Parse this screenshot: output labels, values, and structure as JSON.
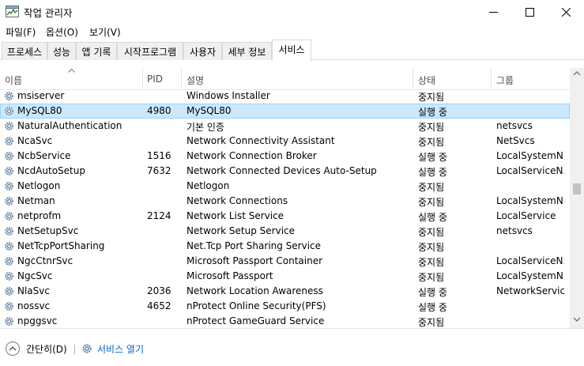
{
  "window": {
    "title": "작업 관리자"
  },
  "menu": [
    {
      "label": "파일(F)"
    },
    {
      "label": "옵션(O)"
    },
    {
      "label": "보기(V)"
    }
  ],
  "tabs": [
    {
      "label": "프로세스",
      "active": false
    },
    {
      "label": "성능",
      "active": false
    },
    {
      "label": "앱 기록",
      "active": false
    },
    {
      "label": "시작프로그램",
      "active": false
    },
    {
      "label": "사용자",
      "active": false
    },
    {
      "label": "세부 정보",
      "active": false
    },
    {
      "label": "서비스",
      "active": true
    }
  ],
  "columns": {
    "name": "이름",
    "pid": "PID",
    "desc": "설명",
    "status": "상태",
    "group": "그룹"
  },
  "rows": [
    {
      "name": "msiserver",
      "pid": "",
      "desc": "Windows Installer",
      "status": "중지됨",
      "group": "",
      "selected": false
    },
    {
      "name": "MySQL80",
      "pid": "4980",
      "desc": "MySQL80",
      "status": "실행 중",
      "group": "",
      "selected": true
    },
    {
      "name": "NaturalAuthentication",
      "pid": "",
      "desc": "기본 인증",
      "status": "중지됨",
      "group": "netsvcs",
      "selected": false
    },
    {
      "name": "NcaSvc",
      "pid": "",
      "desc": "Network Connectivity Assistant",
      "status": "중지됨",
      "group": "NetSvcs",
      "selected": false
    },
    {
      "name": "NcbService",
      "pid": "1516",
      "desc": "Network Connection Broker",
      "status": "실행 중",
      "group": "LocalSystemN...",
      "selected": false
    },
    {
      "name": "NcdAutoSetup",
      "pid": "7632",
      "desc": "Network Connected Devices Auto-Setup",
      "status": "실행 중",
      "group": "LocalServiceN...",
      "selected": false
    },
    {
      "name": "Netlogon",
      "pid": "",
      "desc": "Netlogon",
      "status": "중지됨",
      "group": "",
      "selected": false
    },
    {
      "name": "Netman",
      "pid": "",
      "desc": "Network Connections",
      "status": "중지됨",
      "group": "LocalSystemN...",
      "selected": false
    },
    {
      "name": "netprofm",
      "pid": "2124",
      "desc": "Network List Service",
      "status": "실행 중",
      "group": "LocalService",
      "selected": false
    },
    {
      "name": "NetSetupSvc",
      "pid": "",
      "desc": "Network Setup Service",
      "status": "중지됨",
      "group": "netsvcs",
      "selected": false
    },
    {
      "name": "NetTcpPortSharing",
      "pid": "",
      "desc": "Net.Tcp Port Sharing Service",
      "status": "중지됨",
      "group": "",
      "selected": false
    },
    {
      "name": "NgcCtnrSvc",
      "pid": "",
      "desc": "Microsoft Passport Container",
      "status": "중지됨",
      "group": "LocalServiceN...",
      "selected": false
    },
    {
      "name": "NgcSvc",
      "pid": "",
      "desc": "Microsoft Passport",
      "status": "중지됨",
      "group": "LocalSystemN...",
      "selected": false
    },
    {
      "name": "NlaSvc",
      "pid": "2036",
      "desc": "Network Location Awareness",
      "status": "실행 중",
      "group": "NetworkService",
      "selected": false
    },
    {
      "name": "nossvc",
      "pid": "4652",
      "desc": "nProtect Online Security(PFS)",
      "status": "실행 중",
      "group": "",
      "selected": false
    },
    {
      "name": "npggsvc",
      "pid": "",
      "desc": "nProtect GameGuard Service",
      "status": "중지됨",
      "group": "",
      "selected": false
    }
  ],
  "footer": {
    "collapse_label": "간단히(D)",
    "open_services_label": "서비스 열기"
  },
  "icons": {
    "app": "task-manager-icon",
    "row": "service-gear-icon",
    "collapse": "chevron-up-circle-icon",
    "open_services": "services-gear-icon"
  },
  "colors": {
    "selection_bg": "#cce8ff",
    "selection_border": "#99d1ff",
    "link": "#0066cc"
  }
}
